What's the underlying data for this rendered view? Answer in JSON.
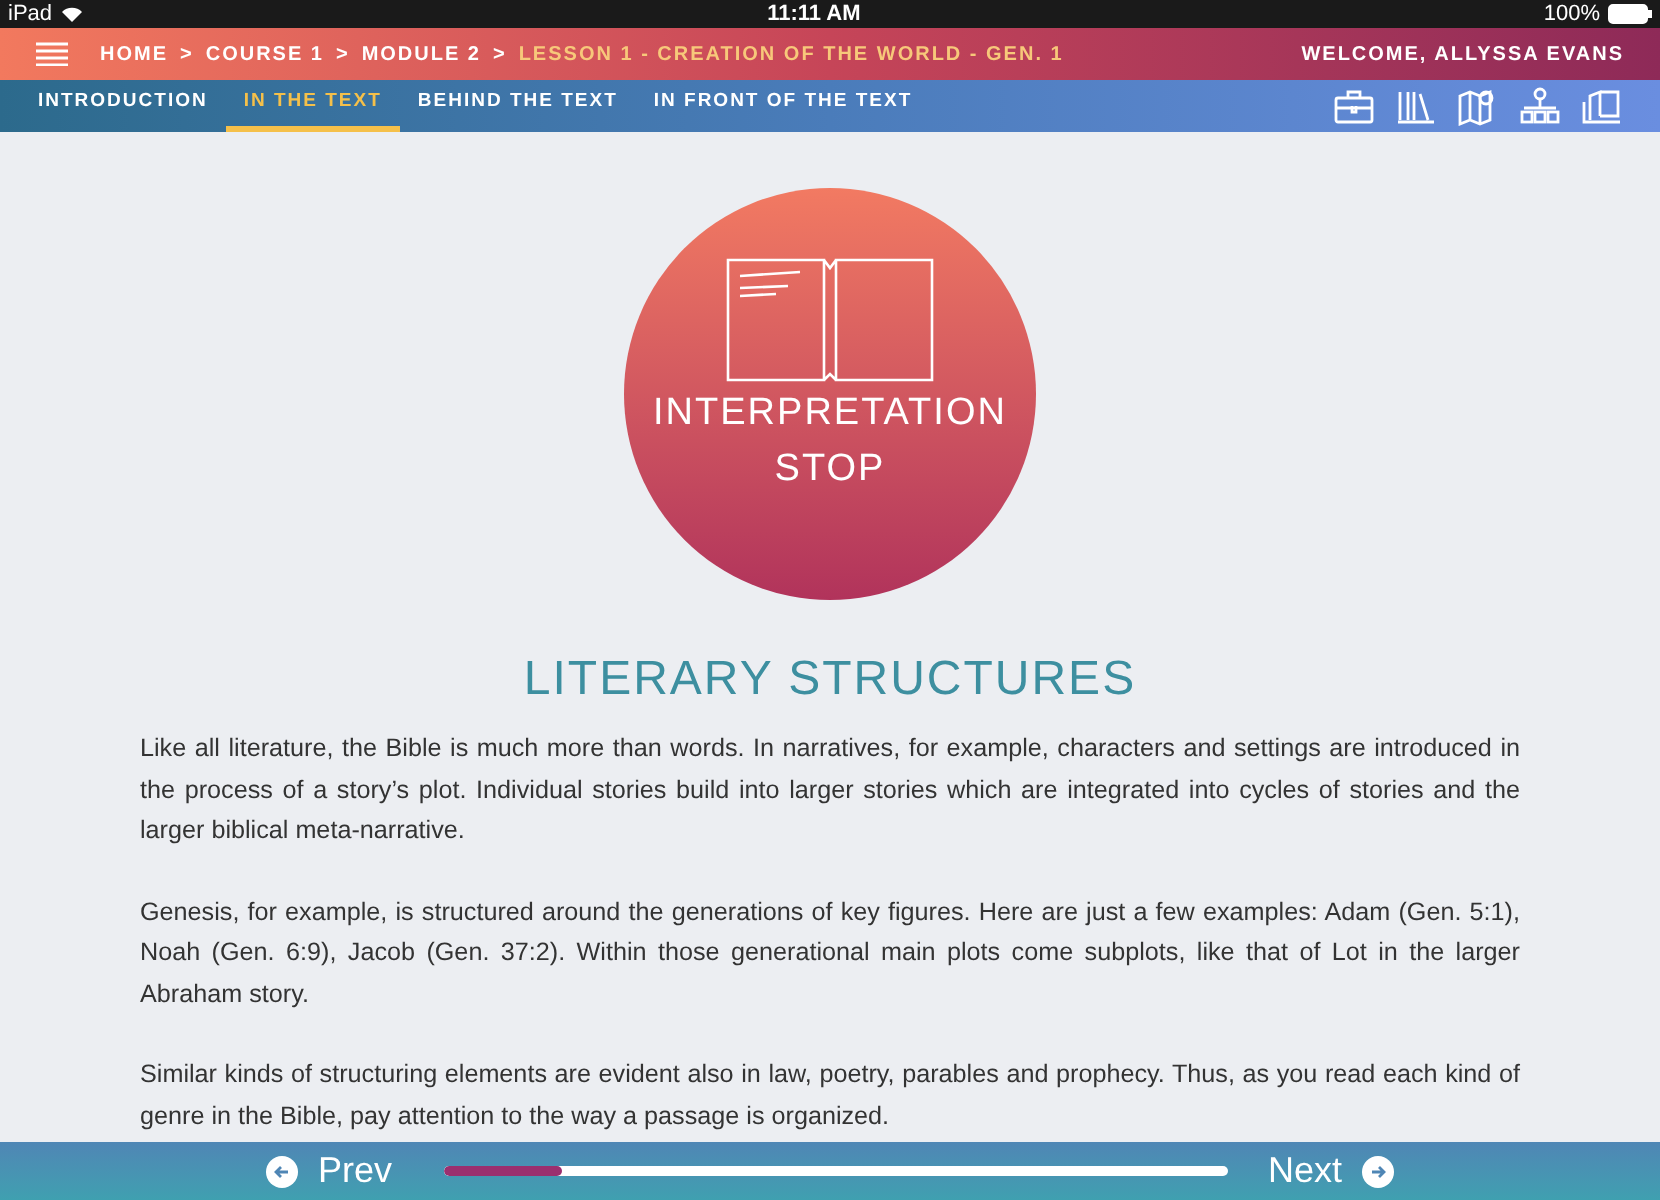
{
  "status_bar": {
    "device": "iPad",
    "time": "11:11 AM",
    "battery": "100%"
  },
  "header": {
    "breadcrumbs": [
      {
        "label": "HOME",
        "current": false
      },
      {
        "label": "COURSE 1",
        "current": false
      },
      {
        "label": "MODULE 2",
        "current": false
      },
      {
        "label": "LESSON 1 - CREATION OF THE WORLD - GEN. 1",
        "current": true
      }
    ],
    "separator": ">",
    "welcome": "WELCOME, ALLYSSA EVANS"
  },
  "tabs": [
    {
      "label": "INTRODUCTION",
      "selected": false
    },
    {
      "label": "IN THE TEXT",
      "selected": true
    },
    {
      "label": "BEHIND THE TEXT",
      "selected": false
    },
    {
      "label": "IN FRONT OF THE TEXT",
      "selected": false
    }
  ],
  "badge": {
    "lines": [
      "INTERPRETATION",
      "STOP"
    ]
  },
  "heading": "LITERARY STRUCTURES",
  "paragraphs": [
    "Like all literature, the Bible is much more than words. In narratives, for example, characters and settings are introduced in the process of a story’s plot. Individual stories build into larger stories which are integrated into cycles of stories and the larger biblical meta-narrative.",
    "Genesis, for example, is structured around the generations of key figures. Here are just a few examples: Adam (Gen. 5:1), Noah (Gen. 6:9), Jacob (Gen. 37:2). Within those generational main plots come subplots, like that of Lot in the larger Abraham story.",
    "Similar kinds of structuring elements are evident also in law, poetry, parables and prophecy. Thus, as you read each kind of genre in the Bible, pay attention to the way a passage is organized."
  ],
  "footer": {
    "prev": "Prev",
    "next": "Next",
    "progress": {
      "level": 0.15
    }
  }
}
